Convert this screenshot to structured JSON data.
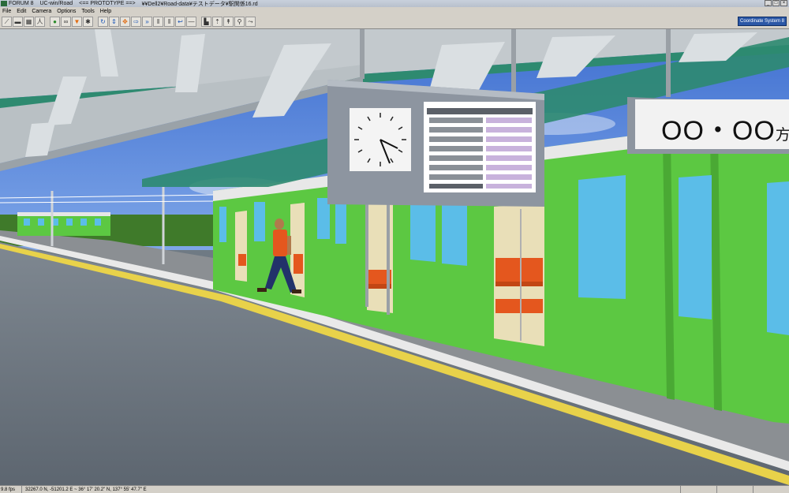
{
  "titlebar": {
    "app_name": "FORUM 8",
    "product": "UC-win/Road",
    "mode": "<== PROTOTYPE ==>",
    "file_path": "¥¥Dell2¥Road-data¥テストデータ¥駅関係16.rd"
  },
  "menu": {
    "items": [
      "File",
      "Edit",
      "Camera",
      "Options",
      "Tools",
      "Help"
    ]
  },
  "toolbar": {
    "coordinate_system_label": "Coordinate System 8"
  },
  "scene": {
    "destination_sign_text": "OO・OO",
    "destination_sign_suffix": "方面",
    "clock_time": "4:38"
  },
  "status": {
    "fps": "9.8 fps",
    "coordinates": "32267.0 N, -51201.2 E  ~  36° 17' 20.2\" N, 137° 55' 47.7\" E"
  },
  "colors": {
    "train_green": "#5cc842",
    "window_blue": "#5bbde8",
    "seat_orange": "#e4571e",
    "platform_gray": "#6f7a84",
    "roof_green": "#2e8a70",
    "sky": "#4a7bd6"
  }
}
